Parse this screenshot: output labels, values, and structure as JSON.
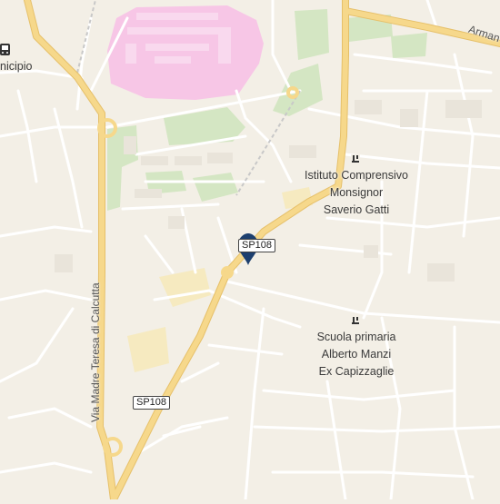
{
  "map": {
    "colors": {
      "background": "#f3efe6",
      "minor_road": "#ffffff",
      "major_road": "#f6d88b",
      "major_road_casing": "#e6c06a",
      "pink_area": "#f7c6e6",
      "pink_building": "#f9d9ee",
      "green_area": "#d4e6c3",
      "yellow_area": "#f6eac0",
      "pin": "#1d3f6e",
      "railway": "#c8c8c8"
    },
    "pois": [
      {
        "icon": "school-icon",
        "lines": [
          "Istituto Comprensivo",
          "Monsignor",
          "Saverio Gatti"
        ]
      },
      {
        "icon": "school-icon",
        "lines": [
          "Scuola primaria",
          "Alberto Manzi",
          "Ex Capizzaglie"
        ]
      }
    ],
    "road_shields": [
      "SP108",
      "SP108"
    ],
    "street_labels": [
      "Via Madre Teresa di Calcutta",
      "Arman"
    ],
    "place_labels": [
      "nicipio"
    ],
    "marker": {
      "icon": "map-pin-icon"
    }
  }
}
